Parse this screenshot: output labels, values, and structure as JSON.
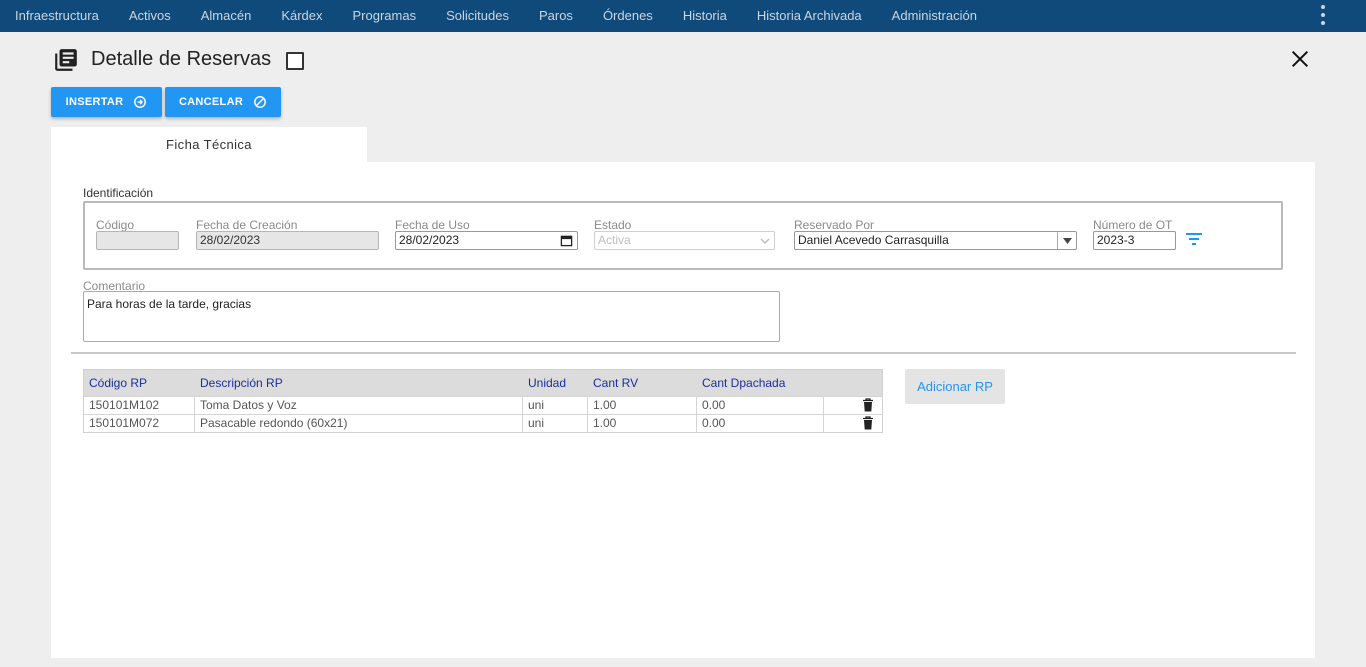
{
  "nav": {
    "items": [
      "Infraestructura",
      "Activos",
      "Almacén",
      "Kárdex",
      "Programas",
      "Solicitudes",
      "Paros",
      "Órdenes",
      "Historia",
      "Historia Archivada",
      "Administración"
    ]
  },
  "header": {
    "title": "Detalle de Reservas"
  },
  "toolbar": {
    "insert_label": "INSERTAR",
    "cancel_label": "CANCELAR"
  },
  "tabs": [
    {
      "label": "Ficha Técnica"
    }
  ],
  "identificacion": {
    "section_label": "Identificación",
    "codigo": {
      "label": "Código",
      "value": ""
    },
    "fecha_creacion": {
      "label": "Fecha de Creación",
      "value": "28/02/2023"
    },
    "fecha_uso": {
      "label": "Fecha de Uso",
      "value": "28/02/2023"
    },
    "estado": {
      "label": "Estado",
      "value": "Activa"
    },
    "reservado_por": {
      "label": "Reservado Por",
      "value": "Daniel Acevedo Carrasquilla"
    },
    "numero_ot": {
      "label": "Número de OT",
      "value": "2023-3"
    }
  },
  "comentario": {
    "label": "Comentario",
    "value": "Para horas de la tarde, gracias"
  },
  "table": {
    "headers": [
      "Código RP",
      "Descripción RP",
      "Unidad",
      "Cant RV",
      "Cant Dpachada"
    ],
    "rows": [
      [
        "150101M102",
        "Toma Datos y Voz",
        "uni",
        "1.00",
        "0.00"
      ],
      [
        "150101M072",
        "Pasacable redondo (60x21)",
        "uni",
        "1.00",
        "0.00"
      ]
    ]
  },
  "add_button_label": "Adicionar RP",
  "colors": {
    "nav_bg": "#0f4a7b",
    "accent": "#2196f3",
    "table_header_text": "#1a2f9c"
  },
  "icons": [
    "document-list-icon",
    "checkbox-icon",
    "close-icon",
    "add-circle-icon",
    "cancel-circle-icon",
    "calendar-icon",
    "chevron-down-icon",
    "filter-icon",
    "trash-icon",
    "more-vert-icon"
  ]
}
